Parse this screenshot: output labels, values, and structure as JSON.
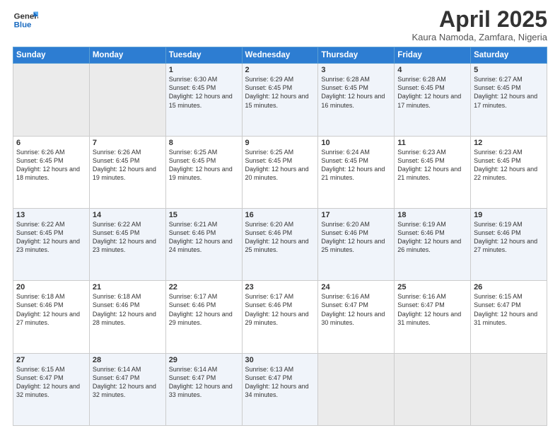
{
  "logo": {
    "line1": "General",
    "line2": "Blue"
  },
  "title": "April 2025",
  "subtitle": "Kaura Namoda, Zamfara, Nigeria",
  "days_header": [
    "Sunday",
    "Monday",
    "Tuesday",
    "Wednesday",
    "Thursday",
    "Friday",
    "Saturday"
  ],
  "weeks": [
    [
      {
        "num": "",
        "info": ""
      },
      {
        "num": "",
        "info": ""
      },
      {
        "num": "1",
        "info": "Sunrise: 6:30 AM\nSunset: 6:45 PM\nDaylight: 12 hours and 15 minutes."
      },
      {
        "num": "2",
        "info": "Sunrise: 6:29 AM\nSunset: 6:45 PM\nDaylight: 12 hours and 15 minutes."
      },
      {
        "num": "3",
        "info": "Sunrise: 6:28 AM\nSunset: 6:45 PM\nDaylight: 12 hours and 16 minutes."
      },
      {
        "num": "4",
        "info": "Sunrise: 6:28 AM\nSunset: 6:45 PM\nDaylight: 12 hours and 17 minutes."
      },
      {
        "num": "5",
        "info": "Sunrise: 6:27 AM\nSunset: 6:45 PM\nDaylight: 12 hours and 17 minutes."
      }
    ],
    [
      {
        "num": "6",
        "info": "Sunrise: 6:26 AM\nSunset: 6:45 PM\nDaylight: 12 hours and 18 minutes."
      },
      {
        "num": "7",
        "info": "Sunrise: 6:26 AM\nSunset: 6:45 PM\nDaylight: 12 hours and 19 minutes."
      },
      {
        "num": "8",
        "info": "Sunrise: 6:25 AM\nSunset: 6:45 PM\nDaylight: 12 hours and 19 minutes."
      },
      {
        "num": "9",
        "info": "Sunrise: 6:25 AM\nSunset: 6:45 PM\nDaylight: 12 hours and 20 minutes."
      },
      {
        "num": "10",
        "info": "Sunrise: 6:24 AM\nSunset: 6:45 PM\nDaylight: 12 hours and 21 minutes."
      },
      {
        "num": "11",
        "info": "Sunrise: 6:23 AM\nSunset: 6:45 PM\nDaylight: 12 hours and 21 minutes."
      },
      {
        "num": "12",
        "info": "Sunrise: 6:23 AM\nSunset: 6:45 PM\nDaylight: 12 hours and 22 minutes."
      }
    ],
    [
      {
        "num": "13",
        "info": "Sunrise: 6:22 AM\nSunset: 6:45 PM\nDaylight: 12 hours and 23 minutes."
      },
      {
        "num": "14",
        "info": "Sunrise: 6:22 AM\nSunset: 6:45 PM\nDaylight: 12 hours and 23 minutes."
      },
      {
        "num": "15",
        "info": "Sunrise: 6:21 AM\nSunset: 6:46 PM\nDaylight: 12 hours and 24 minutes."
      },
      {
        "num": "16",
        "info": "Sunrise: 6:20 AM\nSunset: 6:46 PM\nDaylight: 12 hours and 25 minutes."
      },
      {
        "num": "17",
        "info": "Sunrise: 6:20 AM\nSunset: 6:46 PM\nDaylight: 12 hours and 25 minutes."
      },
      {
        "num": "18",
        "info": "Sunrise: 6:19 AM\nSunset: 6:46 PM\nDaylight: 12 hours and 26 minutes."
      },
      {
        "num": "19",
        "info": "Sunrise: 6:19 AM\nSunset: 6:46 PM\nDaylight: 12 hours and 27 minutes."
      }
    ],
    [
      {
        "num": "20",
        "info": "Sunrise: 6:18 AM\nSunset: 6:46 PM\nDaylight: 12 hours and 27 minutes."
      },
      {
        "num": "21",
        "info": "Sunrise: 6:18 AM\nSunset: 6:46 PM\nDaylight: 12 hours and 28 minutes."
      },
      {
        "num": "22",
        "info": "Sunrise: 6:17 AM\nSunset: 6:46 PM\nDaylight: 12 hours and 29 minutes."
      },
      {
        "num": "23",
        "info": "Sunrise: 6:17 AM\nSunset: 6:46 PM\nDaylight: 12 hours and 29 minutes."
      },
      {
        "num": "24",
        "info": "Sunrise: 6:16 AM\nSunset: 6:47 PM\nDaylight: 12 hours and 30 minutes."
      },
      {
        "num": "25",
        "info": "Sunrise: 6:16 AM\nSunset: 6:47 PM\nDaylight: 12 hours and 31 minutes."
      },
      {
        "num": "26",
        "info": "Sunrise: 6:15 AM\nSunset: 6:47 PM\nDaylight: 12 hours and 31 minutes."
      }
    ],
    [
      {
        "num": "27",
        "info": "Sunrise: 6:15 AM\nSunset: 6:47 PM\nDaylight: 12 hours and 32 minutes."
      },
      {
        "num": "28",
        "info": "Sunrise: 6:14 AM\nSunset: 6:47 PM\nDaylight: 12 hours and 32 minutes."
      },
      {
        "num": "29",
        "info": "Sunrise: 6:14 AM\nSunset: 6:47 PM\nDaylight: 12 hours and 33 minutes."
      },
      {
        "num": "30",
        "info": "Sunrise: 6:13 AM\nSunset: 6:47 PM\nDaylight: 12 hours and 34 minutes."
      },
      {
        "num": "",
        "info": ""
      },
      {
        "num": "",
        "info": ""
      },
      {
        "num": "",
        "info": ""
      }
    ]
  ]
}
